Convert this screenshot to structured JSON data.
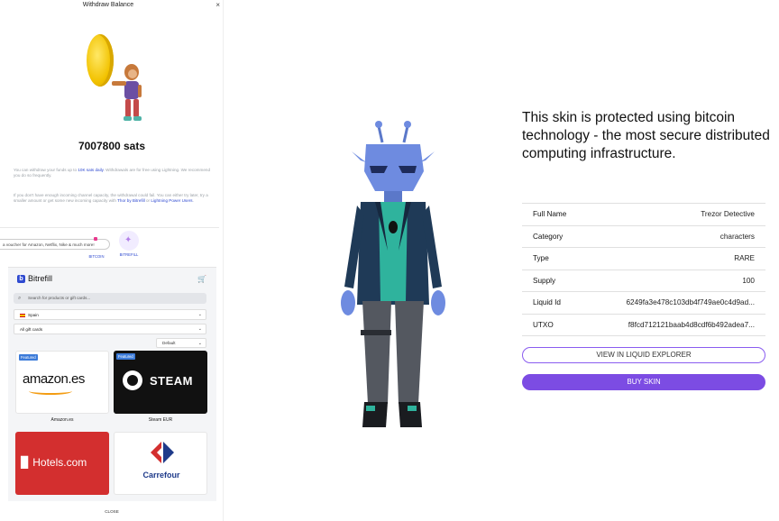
{
  "modal": {
    "title": "Withdraw Balance",
    "close_icon": "×",
    "balance": "7007800 sats",
    "info_line1_pre": "You can withdraw your funds up to ",
    "info_line1_link": "10K sats daily",
    "info_line1_post": ". Withdrawals are for free using Lightning. We recommend you do so frequently.",
    "info_line2_pre": "If you don't have enough incoming channel capacity, the withdrawal could fail. You can either try later, try a smaller amount or get some new incoming capacity with ",
    "info_line2_link1": "Thor by Bitrefill",
    "info_line2_mid": " or ",
    "info_line2_link2": "Lightning Power Users",
    "info_line2_post": ".",
    "voucher_text": "a voucher for Amazon, Netflix, Nike & much more!",
    "tabs": [
      {
        "label": "BITCOIN"
      },
      {
        "label": "BITREFILL"
      }
    ],
    "close_label": "CLOSE"
  },
  "bitrefill": {
    "brand": "Bitrefill",
    "logo_letter": "b",
    "search_placeholder": "Search for products or gift cards...",
    "country": "Spain",
    "category": "All gift cards",
    "sort": "Default",
    "cards": [
      {
        "name": "Amazon.es",
        "logo": "amazon.es",
        "featured": "Featured"
      },
      {
        "name": "Steam EUR",
        "logo": "STEAM",
        "featured": "Featured"
      },
      {
        "logo": "Hotels.com"
      },
      {
        "logo": "Carrefour"
      }
    ]
  },
  "skin": {
    "headline": "This skin is protected using bitcoin technology - the most secure distributed computing infrastructure.",
    "rows": [
      {
        "label": "Full Name",
        "value": "Trezor Detective"
      },
      {
        "label": "Category",
        "value": "characters"
      },
      {
        "label": "Type",
        "value": "RARE"
      },
      {
        "label": "Supply",
        "value": "100"
      },
      {
        "label": "Liquid Id",
        "value": "6249fa3e478c103db4f749ae0c4d9ad..."
      },
      {
        "label": "UTXO",
        "value": "f8fcd712121baab4d8cdf6b492adea7..."
      }
    ],
    "explorer_button": "VIEW IN LIQUID EXPLORER",
    "buy_button": "BUY SKIN"
  },
  "colors": {
    "accent": "#7c4ce3",
    "link": "#2f4ad0",
    "amazon_orange": "#f39c12",
    "hotels_red": "#d32f2f"
  }
}
